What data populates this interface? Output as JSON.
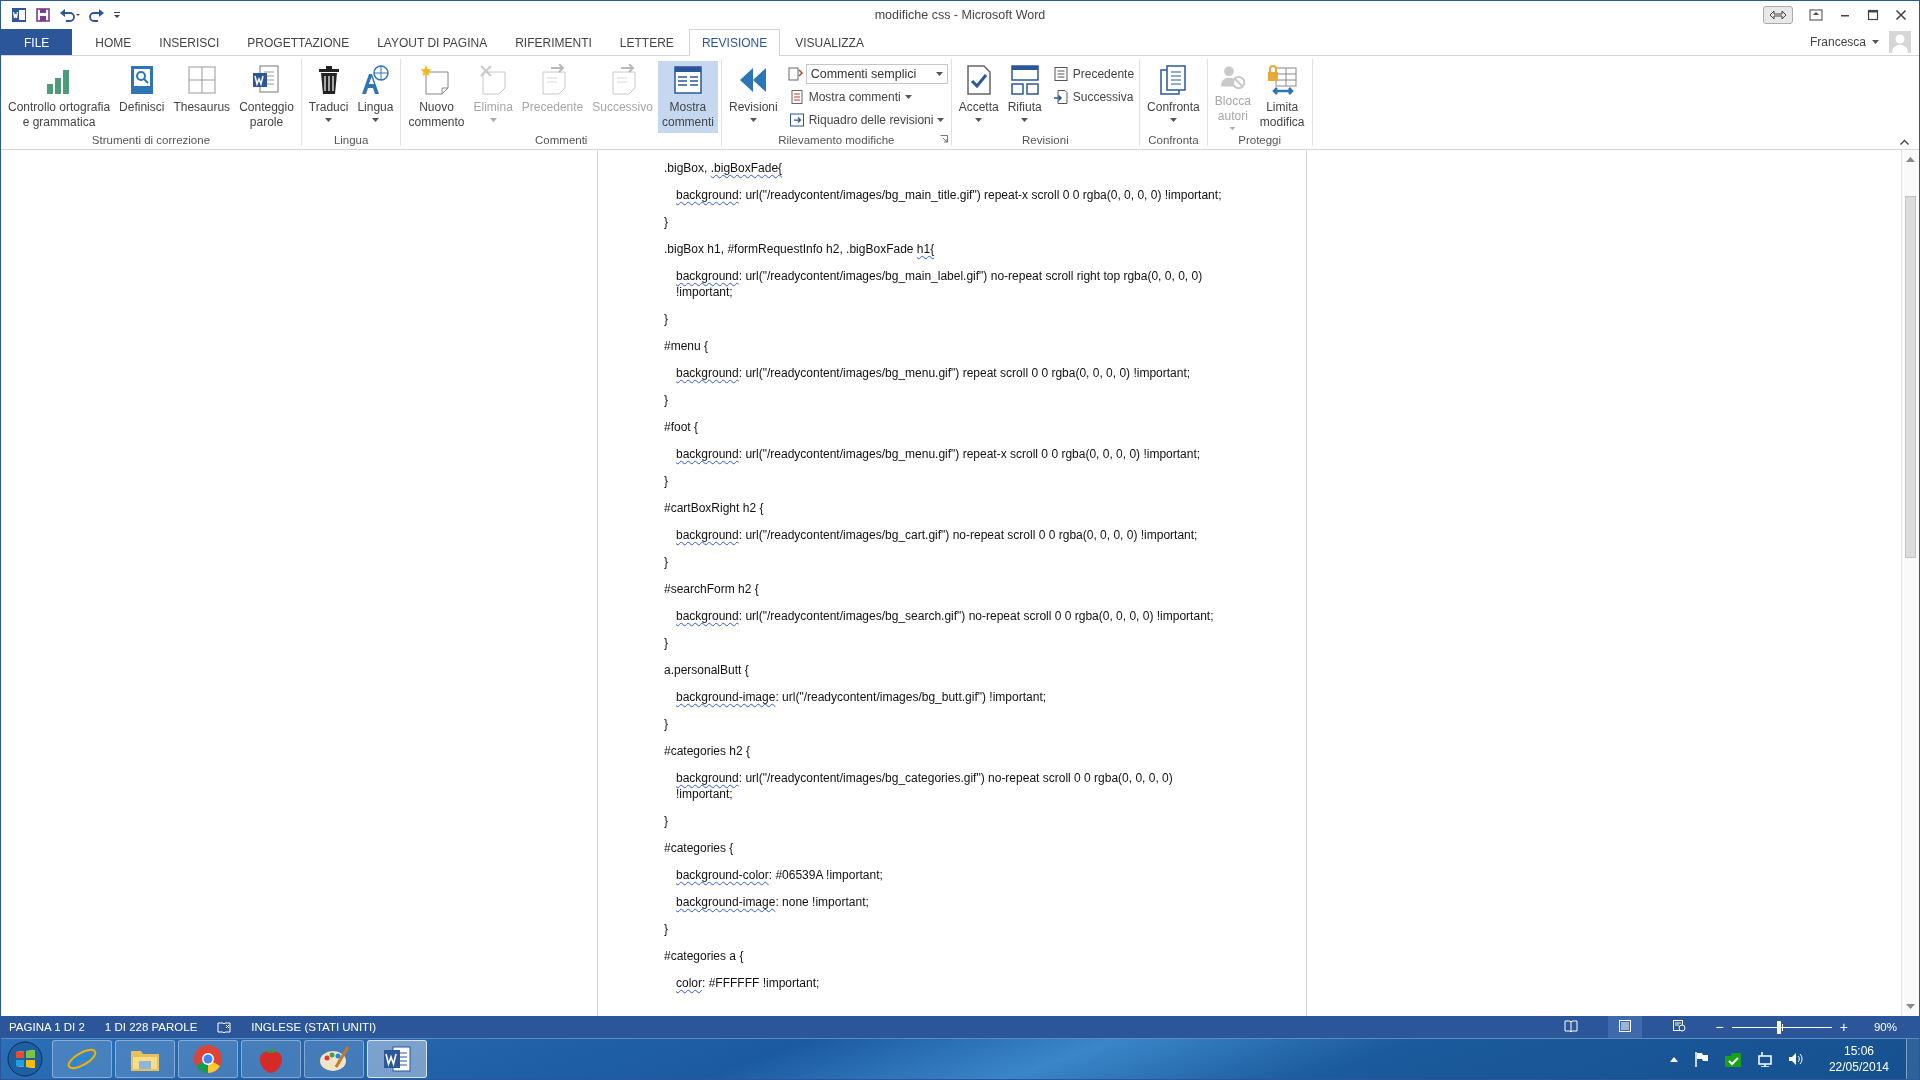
{
  "window": {
    "title": "modifiche css - Microsoft Word",
    "user": "Francesca"
  },
  "tabs": [
    {
      "label": "FILE",
      "kind": "file",
      "selected": false
    },
    {
      "label": "HOME",
      "kind": "tab",
      "selected": false
    },
    {
      "label": "INSERISCI",
      "kind": "tab",
      "selected": false
    },
    {
      "label": "PROGETTAZIONE",
      "kind": "tab",
      "selected": false
    },
    {
      "label": "LAYOUT DI PAGINA",
      "kind": "tab",
      "selected": false
    },
    {
      "label": "RIFERIMENTI",
      "kind": "tab",
      "selected": false
    },
    {
      "label": "LETTERE",
      "kind": "tab",
      "selected": false
    },
    {
      "label": "REVISIONE",
      "kind": "tab",
      "selected": true
    },
    {
      "label": "VISUALIZZA",
      "kind": "tab",
      "selected": false
    }
  ],
  "ribbon": {
    "groups": [
      {
        "label": "Strumenti di correzione",
        "launcher": false,
        "items": [
          {
            "kind": "large",
            "label": "Controllo ortografia\ne grammatica",
            "disabled": false,
            "dropdown": false,
            "selected": false
          },
          {
            "kind": "large",
            "label": "Definisci",
            "disabled": false,
            "dropdown": false,
            "selected": false
          },
          {
            "kind": "large",
            "label": "Thesaurus",
            "disabled": false,
            "dropdown": false,
            "selected": false
          },
          {
            "kind": "large",
            "label": "Conteggio\nparole",
            "disabled": false,
            "dropdown": false,
            "selected": false
          }
        ]
      },
      {
        "label": "Lingua",
        "launcher": false,
        "items": [
          {
            "kind": "large",
            "label": "Traduci",
            "disabled": false,
            "dropdown": true,
            "selected": false
          },
          {
            "kind": "large",
            "label": "Lingua",
            "disabled": false,
            "dropdown": true,
            "selected": false
          }
        ]
      },
      {
        "label": "Commenti",
        "launcher": false,
        "items": [
          {
            "kind": "large",
            "label": "Nuovo\ncommento",
            "disabled": false,
            "dropdown": false,
            "selected": false
          },
          {
            "kind": "large",
            "label": "Elimina",
            "disabled": true,
            "dropdown": true,
            "selected": false
          },
          {
            "kind": "large",
            "label": "Precedente",
            "disabled": true,
            "dropdown": false,
            "selected": false
          },
          {
            "kind": "large",
            "label": "Successivo",
            "disabled": true,
            "dropdown": false,
            "selected": false
          },
          {
            "kind": "large",
            "label": "Mostra\ncommenti",
            "disabled": false,
            "dropdown": false,
            "selected": true
          }
        ]
      },
      {
        "label": "Rilevamento modifiche",
        "launcher": true,
        "items": [
          {
            "kind": "large",
            "label": "Revisioni",
            "disabled": false,
            "dropdown": true,
            "selected": false
          },
          {
            "kind": "stack",
            "items": [
              {
                "kind": "combo",
                "value": "Commenti semplici",
                "disabled": false,
                "dropdown": true
              },
              {
                "kind": "small",
                "label": "Mostra commenti",
                "disabled": false,
                "dropdown": true
              },
              {
                "kind": "small",
                "label": "Riquadro delle revisioni",
                "disabled": false,
                "dropdown": true
              }
            ]
          }
        ]
      },
      {
        "label": "Revisioni",
        "launcher": false,
        "items": [
          {
            "kind": "large",
            "label": "Accetta",
            "disabled": false,
            "dropdown": true,
            "selected": false
          },
          {
            "kind": "large",
            "label": "Rifiuta",
            "disabled": false,
            "dropdown": true,
            "selected": false
          },
          {
            "kind": "stack",
            "items": [
              {
                "kind": "small",
                "label": "Precedente",
                "disabled": false,
                "dropdown": false
              },
              {
                "kind": "small",
                "label": "Successiva",
                "disabled": false,
                "dropdown": false
              }
            ]
          }
        ]
      },
      {
        "label": "Confronta",
        "launcher": false,
        "items": [
          {
            "kind": "large",
            "label": "Confronta",
            "disabled": false,
            "dropdown": true,
            "selected": false
          }
        ]
      },
      {
        "label": "Proteggi",
        "launcher": false,
        "items": [
          {
            "kind": "large",
            "label": "Blocca\nautori",
            "disabled": true,
            "dropdown": true,
            "selected": false
          },
          {
            "kind": "large",
            "label": "Limita\nmodifica",
            "disabled": false,
            "dropdown": false,
            "selected": false
          }
        ]
      }
    ]
  },
  "document": {
    "paragraphs": [
      {
        "kind": "selector",
        "segments": [
          {
            "text": ".bigBox, ",
            "flagged": false
          },
          {
            "text": ".bigBoxFade{",
            "flagged": true
          }
        ]
      },
      {
        "kind": "declaration",
        "segments": [
          {
            "text": "background",
            "flagged": true
          },
          {
            "text": ": url(\"/readycontent/images/bg_main_title.gif\") repeat-x scroll 0 0 rgba(0, 0, 0, 0) !important;",
            "flagged": false
          }
        ]
      },
      {
        "kind": "close",
        "text": "}"
      },
      {
        "kind": "selector",
        "segments": [
          {
            "text": ".bigBox h1, #formRequestInfo h2, .bigBoxFade ",
            "flagged": false
          },
          {
            "text": "h1{",
            "flagged": true
          }
        ]
      },
      {
        "kind": "declaration",
        "segments": [
          {
            "text": "background",
            "flagged": true
          },
          {
            "text": ": url(\"/readycontent/images/bg_main_label.gif\") no-repeat scroll right top rgba(0, 0, 0, 0) !important;",
            "flagged": false
          }
        ]
      },
      {
        "kind": "close",
        "text": "}"
      },
      {
        "kind": "selector",
        "segments": [
          {
            "text": "#menu {",
            "flagged": false
          }
        ]
      },
      {
        "kind": "declaration",
        "segments": [
          {
            "text": "background",
            "flagged": true
          },
          {
            "text": ": url(\"/readycontent/images/bg_menu.gif\") repeat scroll 0 0 rgba(0, 0, 0, 0) !important;",
            "flagged": false
          }
        ]
      },
      {
        "kind": "close",
        "text": "}"
      },
      {
        "kind": "selector",
        "segments": [
          {
            "text": "#foot {",
            "flagged": false
          }
        ]
      },
      {
        "kind": "declaration",
        "segments": [
          {
            "text": "background",
            "flagged": true
          },
          {
            "text": ": url(\"/readycontent/images/bg_menu.gif\") repeat-x scroll 0 0 rgba(0, 0, 0, 0) !important;",
            "flagged": false
          }
        ]
      },
      {
        "kind": "close",
        "text": "}"
      },
      {
        "kind": "selector",
        "segments": [
          {
            "text": "#cartBoxRight h2 {",
            "flagged": false
          }
        ]
      },
      {
        "kind": "declaration",
        "segments": [
          {
            "text": "background",
            "flagged": true
          },
          {
            "text": ": url(\"/readycontent/images/bg_cart.gif\") no-repeat scroll 0 0 rgba(0, 0, 0, 0) !important;",
            "flagged": false
          }
        ]
      },
      {
        "kind": "close",
        "text": "}"
      },
      {
        "kind": "selector",
        "segments": [
          {
            "text": "#searchForm h2 {",
            "flagged": false
          }
        ]
      },
      {
        "kind": "declaration",
        "segments": [
          {
            "text": "background",
            "flagged": true
          },
          {
            "text": ": url(\"/readycontent/images/bg_search.gif\") no-repeat scroll 0 0 rgba(0, 0, 0, 0) !important;",
            "flagged": false
          }
        ]
      },
      {
        "kind": "close",
        "text": "}"
      },
      {
        "kind": "selector",
        "segments": [
          {
            "text": "a.personalButt {",
            "flagged": false
          }
        ]
      },
      {
        "kind": "declaration",
        "segments": [
          {
            "text": "background-image",
            "flagged": true
          },
          {
            "text": ": url(\"/readycontent/images/bg_butt.gif\") !important;",
            "flagged": false
          }
        ]
      },
      {
        "kind": "close",
        "text": "}"
      },
      {
        "kind": "selector",
        "segments": [
          {
            "text": "#categories h2 {",
            "flagged": false
          }
        ]
      },
      {
        "kind": "declaration",
        "segments": [
          {
            "text": "background",
            "flagged": true
          },
          {
            "text": ": url(\"/readycontent/images/bg_categories.gif\") no-repeat scroll 0 0 rgba(0, 0, 0, 0) !important;",
            "flagged": false
          }
        ]
      },
      {
        "kind": "close",
        "text": "}"
      },
      {
        "kind": "selector",
        "segments": [
          {
            "text": "#categories {",
            "flagged": false
          }
        ]
      },
      {
        "kind": "declaration",
        "segments": [
          {
            "text": "background-color",
            "flagged": true
          },
          {
            "text": ": #06539A !important;",
            "flagged": false
          }
        ]
      },
      {
        "kind": "declaration",
        "segments": [
          {
            "text": "background-image",
            "flagged": true
          },
          {
            "text": ": none !important;",
            "flagged": false
          }
        ]
      },
      {
        "kind": "close",
        "text": "}"
      },
      {
        "kind": "selector",
        "segments": [
          {
            "text": "#categories a {",
            "flagged": false
          }
        ]
      },
      {
        "kind": "declaration",
        "segments": [
          {
            "text": "color",
            "flagged": true
          },
          {
            "text": ": #FFFFFF !important;",
            "flagged": false
          }
        ]
      }
    ]
  },
  "status_bar": {
    "page": "PAGINA 1 DI 2",
    "words": "1 DI 228 PAROLE",
    "language": "INGLESE (STATI UNITI)",
    "views": [
      {
        "selected": false
      },
      {
        "selected": true
      },
      {
        "selected": false
      }
    ],
    "zoom": {
      "out": "−",
      "in": "+",
      "level": 0.47,
      "reading": "90%"
    }
  },
  "taskbar": {
    "apps": [
      {
        "selected": false
      },
      {
        "selected": false
      },
      {
        "selected": false
      },
      {
        "selected": false
      },
      {
        "selected": false
      },
      {
        "selected": true
      }
    ],
    "time": "15:06",
    "date": "22/05/2014"
  }
}
